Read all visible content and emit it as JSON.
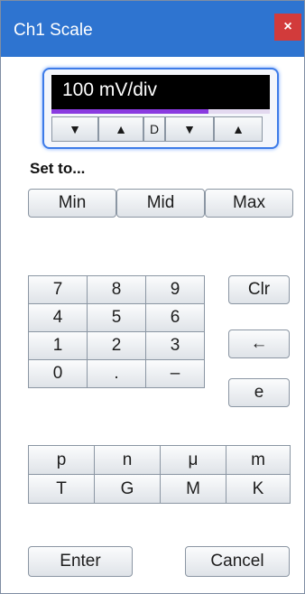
{
  "window": {
    "title": "Ch1 Scale",
    "close_glyph": "×"
  },
  "display": {
    "value": "100 mV/div",
    "progress_fraction": 0.72,
    "steppers": [
      {
        "glyph": "▼",
        "name": "coarse-down-button"
      },
      {
        "glyph": "▲",
        "name": "coarse-up-button"
      },
      {
        "glyph": "D",
        "name": "default-button"
      },
      {
        "glyph": "▼",
        "name": "fine-down-button"
      },
      {
        "glyph": "▲",
        "name": "fine-up-button"
      }
    ]
  },
  "set_to": {
    "label": "Set to...",
    "buttons": [
      "Min",
      "Mid",
      "Max"
    ]
  },
  "keypad": {
    "digits": [
      "7",
      "8",
      "9",
      "4",
      "5",
      "6",
      "1",
      "2",
      "3",
      "0",
      ".",
      "–"
    ],
    "clear": "Clr",
    "backspace": "←",
    "exponent": "e"
  },
  "units": {
    "row1": [
      "p",
      "n",
      "μ",
      "m"
    ],
    "row2": [
      "T",
      "G",
      "M",
      "K"
    ]
  },
  "actions": {
    "enter": "Enter",
    "cancel": "Cancel"
  },
  "colors": {
    "titlebar": "#2e74d0",
    "close": "#d23b3b",
    "accent": "#3d7be8",
    "progress": "#8a3be0"
  }
}
